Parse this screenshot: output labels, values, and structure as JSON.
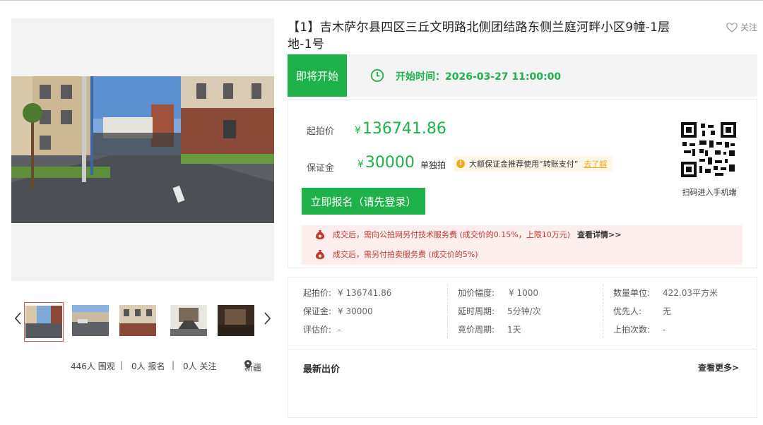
{
  "listing": {
    "title": "【1】吉木萨尔县四区三丘文明路北侧团结路东侧兰庭河畔小区9幢-1层地-1号",
    "follow_label": "关注"
  },
  "status": {
    "tag": "即将开始",
    "start_time_label": "开始时间：2026-03-27 11:00:00"
  },
  "pricing": {
    "start_price_label": "起拍价",
    "start_price_currency": "¥",
    "start_price_value": "136741.86",
    "deposit_label": "保证金",
    "deposit_currency": "¥",
    "deposit_value": "30000",
    "single_label": "单独拍",
    "tip_text": "大额保证金推荐使用“转账支付”",
    "tip_link": "去了解",
    "signup_button": "立即报名（请先登录）",
    "qr_caption": "扫码进入手机端"
  },
  "fees": [
    {
      "text": "成交后，需向公拍网另付技术服务费 (成交价的0.15%，上限10万元)",
      "link": "查看详情>>"
    },
    {
      "text": "成交后，需另付拍卖服务费 (成交价的5%)",
      "link": ""
    }
  ],
  "details": {
    "col1": [
      {
        "k": "起拍价:",
        "v": "¥ 136741.86"
      },
      {
        "k": "保证金:",
        "v": "¥ 30000"
      },
      {
        "k": "评估价:",
        "v": "-"
      }
    ],
    "col2": [
      {
        "k": "加价幅度:",
        "v": "¥ 1000"
      },
      {
        "k": "延时周期:",
        "v": "5分钟/次"
      },
      {
        "k": "竞价周期:",
        "v": "1天"
      }
    ],
    "col3": [
      {
        "k": "数量单位:",
        "v": "422.03平方米"
      },
      {
        "k": "优先人:",
        "v": "无"
      },
      {
        "k": "上拍次数:",
        "v": "-"
      }
    ]
  },
  "bids": {
    "title": "最新出价",
    "more": "查看更多>"
  },
  "stats": {
    "views": "446人 围观",
    "signups": "0人 报名",
    "follows": "0人 关注",
    "location": "新疆",
    "sep": "|"
  },
  "colors": {
    "accent_green": "#1fb14a",
    "fee_red": "#c0392b",
    "tip_orange": "#f5a623"
  },
  "icons": {
    "follow": "heart-outline-icon",
    "clock": "clock-icon",
    "tip": "info-circle-icon",
    "fee": "money-bag-icon",
    "location": "location-pin-icon",
    "prev": "chevron-left-icon",
    "next": "chevron-right-icon"
  }
}
